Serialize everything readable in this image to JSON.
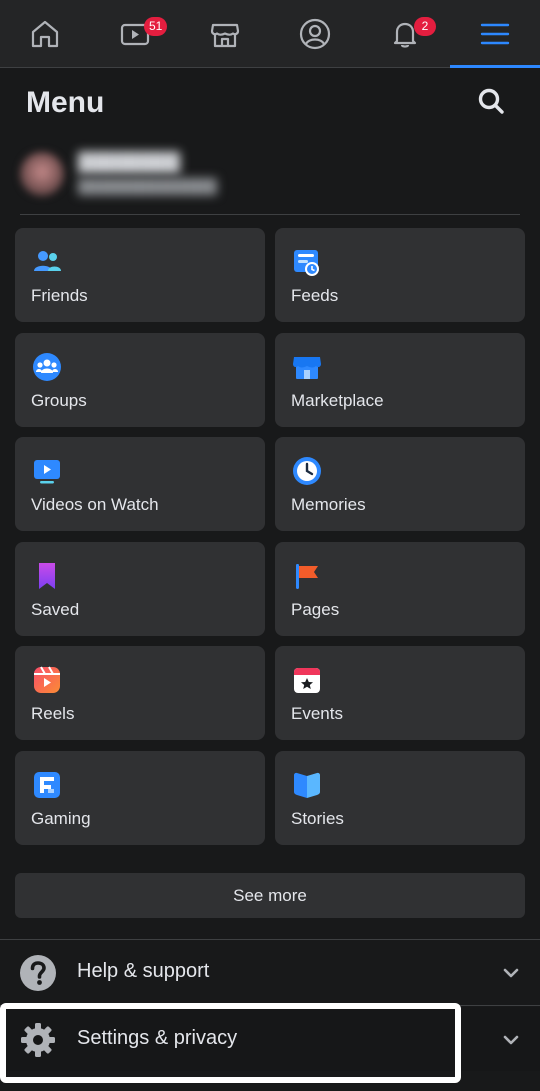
{
  "nav": {
    "tabs": [
      {
        "name": "home",
        "icon": "home-icon"
      },
      {
        "name": "watch",
        "icon": "video-icon",
        "badge": "51"
      },
      {
        "name": "marketplace",
        "icon": "store-icon"
      },
      {
        "name": "profile",
        "icon": "profile-icon"
      },
      {
        "name": "notifications",
        "icon": "bell-icon",
        "badge": "2"
      },
      {
        "name": "menu",
        "icon": "hamburger-icon",
        "active": true
      }
    ],
    "accent_color": "#2d88ff",
    "badge_color": "#e41e3f"
  },
  "header": {
    "title": "Menu"
  },
  "shortcuts": [
    {
      "label": "Friends",
      "icon": "friends-icon"
    },
    {
      "label": "Feeds",
      "icon": "feeds-icon"
    },
    {
      "label": "Groups",
      "icon": "groups-icon"
    },
    {
      "label": "Marketplace",
      "icon": "marketplace-icon"
    },
    {
      "label": "Videos on Watch",
      "icon": "watch-icon"
    },
    {
      "label": "Memories",
      "icon": "memories-icon"
    },
    {
      "label": "Saved",
      "icon": "saved-icon"
    },
    {
      "label": "Pages",
      "icon": "pages-icon"
    },
    {
      "label": "Reels",
      "icon": "reels-icon"
    },
    {
      "label": "Events",
      "icon": "events-icon"
    },
    {
      "label": "Gaming",
      "icon": "gaming-icon"
    },
    {
      "label": "Stories",
      "icon": "stories-icon"
    }
  ],
  "see_more": {
    "label": "See more"
  },
  "rows": {
    "help": {
      "label": "Help & support",
      "icon": "help-icon"
    },
    "settings": {
      "label": "Settings & privacy",
      "icon": "gear-icon"
    }
  },
  "colors": {
    "background": "#18191a",
    "card": "#303133",
    "text": "#e4e6eb"
  }
}
